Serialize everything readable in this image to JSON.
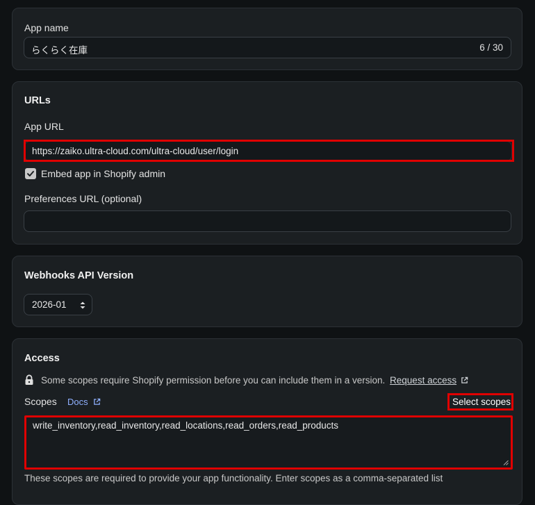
{
  "app_name": {
    "label": "App name",
    "value": "らくらく在庫",
    "counter": "6 / 30"
  },
  "urls": {
    "heading": "URLs",
    "app_url_label": "App URL",
    "app_url_value": "https://zaiko.ultra-cloud.com/ultra-cloud/user/login",
    "embed_label": "Embed app in Shopify admin",
    "embed_checked": true,
    "preferences_label": "Preferences URL (optional)",
    "preferences_value": ""
  },
  "webhooks": {
    "heading": "Webhooks API Version",
    "selected": "2026-01"
  },
  "access": {
    "heading": "Access",
    "notice": "Some scopes require Shopify permission before you can include them in a version.",
    "request_access": "Request access",
    "scopes_label": "Scopes",
    "docs_label": "Docs",
    "select_scopes": "Select scopes",
    "scopes_value": "write_inventory,read_inventory,read_locations,read_orders,read_products",
    "help_text": "These scopes are required to provide your app functionality. Enter scopes as a comma-separated list"
  },
  "colors": {
    "background": "#0f1214",
    "card": "#1b1f22",
    "highlight": "#e00000",
    "docs_link": "#8fb0ff"
  }
}
